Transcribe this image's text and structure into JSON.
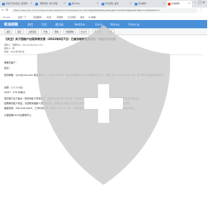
{
  "browser": {
    "tabs": [
      {
        "title": "请进行安全验证_百度网盘"
      },
      {
        "title": "【网页版】用户管理"
      },
      {
        "title": "用户中心"
      },
      {
        "title": "有关通知_百度"
      },
      {
        "title": "有关邮件"
      },
      {
        "title": "新浪邮箱"
      }
    ],
    "window_controls": {
      "minimize": "–",
      "maximize": "□",
      "close": "×"
    },
    "url": "https://mail.sina.com.cn/classic/index.php#action=mailview&mid=1ZmVQJQ5MzQ0MzAyN2QyNjU1YzA1MTA0Mjg0Mzk3MjhmYjY0MjI0&fid=1",
    "bookmarks": [
      "Google",
      "百度一下",
      "百度翻译",
      "新浪",
      "凤凰网",
      "东方财富",
      "淘宝",
      "QQ邮箱"
    ]
  },
  "app": {
    "logo": "新浪邮箱",
    "nav": [
      "收信",
      "写信",
      "通讯录",
      "NetDisk",
      "Early",
      "Money",
      "Sharing"
    ]
  },
  "toolbar": {
    "buttons": [
      "返回",
      "回复",
      "全部回复",
      "转发",
      "删除",
      "彻底删除",
      "标记为",
      "移动到",
      "更多"
    ]
  },
  "email": {
    "subject": "【关注】关于您账户出现异常交易（2022年8月7日）已被冻结的重要通知（请查收并处理）",
    "from": "发件人：客服中心 <service@yxia.com>",
    "to": "收件人：我",
    "date": "时间：2022年8月8日",
    "lines": [
      "尊敬的客户：",
      "您好！",
      "您的邮箱：2jxn@yxia.com 电话号码为：13860208888，我司大通金融Hex平台对您账户有三个，截止今天（2022年8月10日）账户累计资金余额明细如下：",
      "余额：1.1-1.4(元)",
      "USDT：476.00美元",
      "您的账户由于最近一段时间处于异常状态，资金在交易过程中有问题，导致您在我司账户内的资金被冻结，按照监管要求请您尽快处理。",
      "如需解冻账户资金，请您联系客服人员协助处理，按照相关流程提交资料并缴纳相应的保证金，我们将在收到后尽快为您办理。",
      "客服热线：400-XXX-XXXX，工作时间为周一至周日 9:00-21:00，请在规定时间内与我们联系，逾期未处理将影响您的账户使用。",
      "大通金融Hex平台客服中心"
    ]
  },
  "overlay": {
    "icon": "shield-icon",
    "fill": "#cccccc",
    "opacity": 0.82
  }
}
